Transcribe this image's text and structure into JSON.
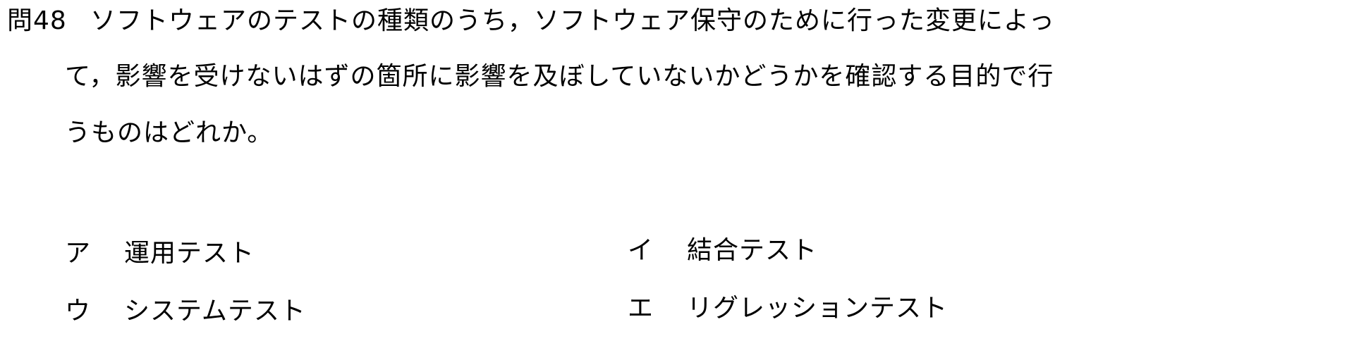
{
  "question": {
    "number": "問48",
    "line1": "ソフトウェアのテストの種類のうち，ソフトウェア保守のために行った変更によっ",
    "line2": "て，影響を受けないはずの箇所に影響を及ぼしていないかどうかを確認する目的で行",
    "line3": "うものはどれか。"
  },
  "choices": [
    {
      "key": "ア",
      "text": "運用テスト"
    },
    {
      "key": "イ",
      "text": "結合テスト"
    },
    {
      "key": "ウ",
      "text": "システムテスト"
    },
    {
      "key": "エ",
      "text": "リグレッションテスト"
    }
  ]
}
